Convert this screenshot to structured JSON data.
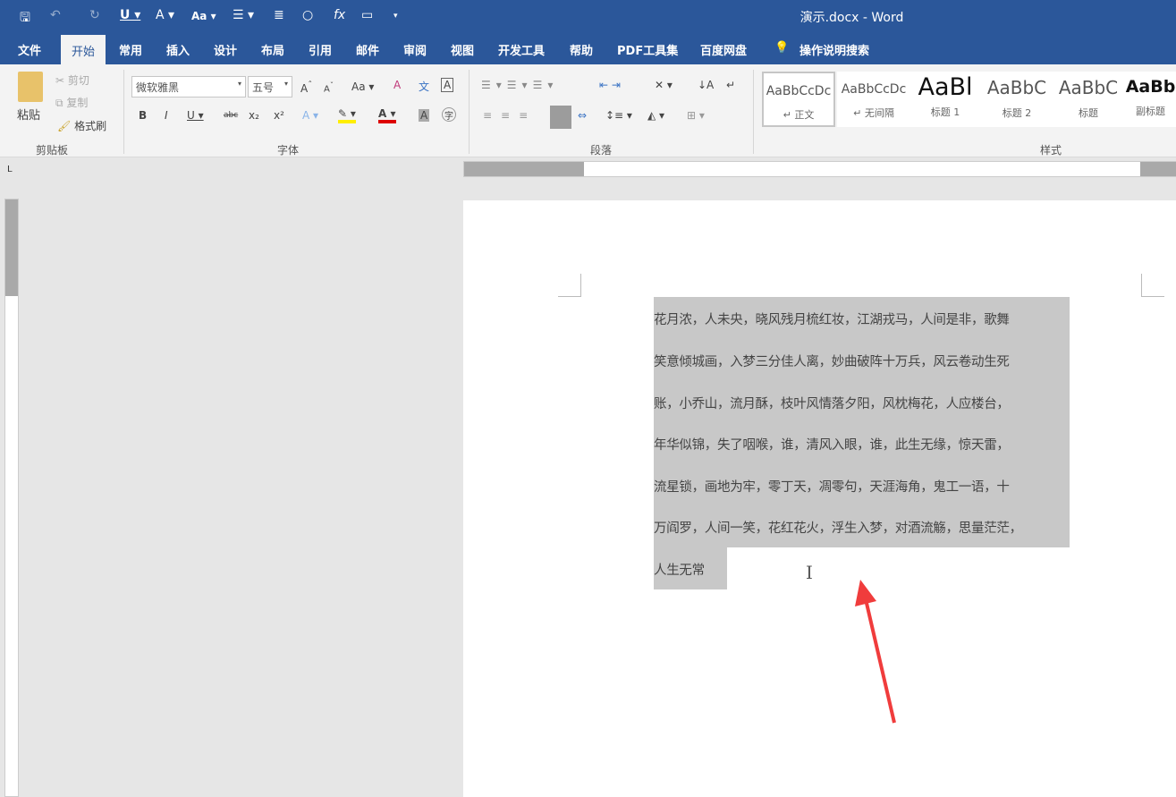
{
  "titlebar": {
    "title": "演示.docx  -  Word",
    "quick_access": [
      "save-icon",
      "undo-icon",
      "redo-icon",
      "underline-icon",
      "text-effects-icon",
      "change-case-icon",
      "bullets-icon",
      "align-icon",
      "shape-icon",
      "formula-icon",
      "comment-icon",
      "customize-icon"
    ]
  },
  "tabs": [
    "文件",
    "开始",
    "常用",
    "插入",
    "设计",
    "布局",
    "引用",
    "邮件",
    "审阅",
    "视图",
    "开发工具",
    "帮助",
    "PDF工具集",
    "百度网盘",
    "操作说明搜索"
  ],
  "active_tab": "开始",
  "clipboard": {
    "paste": "粘贴",
    "cut": "剪切",
    "copy": "复制",
    "format_painter": "格式刷",
    "group": "剪贴板"
  },
  "font": {
    "name": "微软雅黑",
    "size": "五号",
    "group": "字体",
    "case": "Aa"
  },
  "paragraph": {
    "group": "段落"
  },
  "styles": {
    "group": "样式",
    "items": [
      {
        "preview": "AaBbCcDc",
        "name": "↵ 正文"
      },
      {
        "preview": "AaBbCcDc",
        "name": "↵ 无间隔"
      },
      {
        "preview": "AaBl",
        "name": "标题 1"
      },
      {
        "preview": "AaBbC",
        "name": "标题 2"
      },
      {
        "preview": "AaBbC",
        "name": "标题"
      },
      {
        "preview": "AaBb",
        "name": "副标题"
      }
    ]
  },
  "document": {
    "lines": [
      "花月浓，人未央，晓风残月梳红妆，江湖戎马，人间是非，歌舞",
      "笑意倾城画，入梦三分佳人离，妙曲破阵十万兵，风云卷动生死",
      "账，小乔山，流月酥，枝叶风情落夕阳，风枕梅花，人应楼台，",
      "年华似锦，失了咽喉，谁，清风入眼，谁，此生无缘，惊天雷，",
      "流星锁，画地为牢，零丁天，凋零句，天涯海角，鬼工一语，十",
      "万阎罗，人间一笑，花红花火，浮生入梦，对酒流觞，思量茫茫，",
      "人生无常"
    ],
    "selected": true
  },
  "colors": {
    "brand": "#2b579a",
    "selection": "#c8c8c8",
    "arrow": "#f03c3c"
  }
}
